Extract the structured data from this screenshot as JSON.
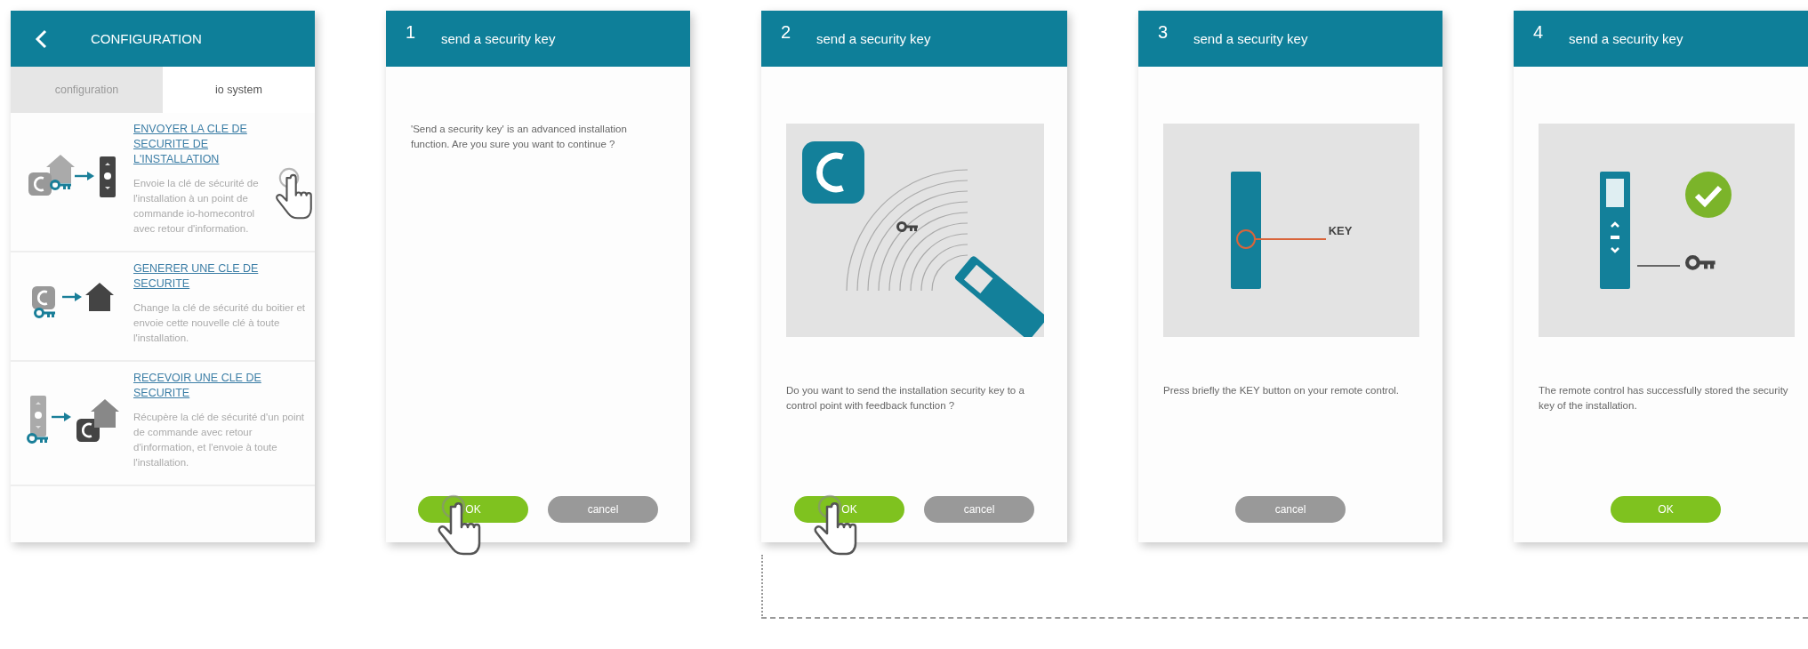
{
  "screens": [
    {
      "kind": "menu",
      "header": {
        "title": "CONFIGURATION",
        "back": true
      },
      "tabs": [
        {
          "label": "configuration",
          "selected": false
        },
        {
          "label": "io system",
          "selected": true
        }
      ],
      "items": [
        {
          "kind": "send",
          "title": "ENVOYER LA CLE DE SECURITE DE L'INSTALLATION",
          "description": "Envoie la clé de sécurité de l'installation à un point de commande io-homecontrol avec retour d'information.",
          "pressed": true
        },
        {
          "kind": "generate",
          "title": "GENERER UNE CLE DE SECURITE",
          "description": "Change la clé de sécurité du boitier et envoie cette nouvelle clé à toute l'installation.",
          "pressed": false
        },
        {
          "kind": "receive",
          "title": "RECEVOIR UNE CLE DE SECURITE",
          "description": "Récupère la clé de sécurité d'un point de commande avec retour d'information, et l'envoie à toute l'installation.",
          "pressed": false
        }
      ]
    },
    {
      "kind": "step",
      "header": {
        "step": "1",
        "title": "send a security key"
      },
      "message": "'Send a security key' is an advanced installation function. Are you sure you want to continue ?",
      "buttons": [
        {
          "kind": "confirm",
          "label": "OK",
          "pressed": true
        },
        {
          "kind": "cancel",
          "label": "cancel",
          "pressed": false
        }
      ]
    },
    {
      "kind": "step",
      "header": {
        "step": "2",
        "title": "send a security key"
      },
      "illustration": {
        "kind": "transmit"
      },
      "message": "Do you want to send the installation security key to a control point with feedback function ?",
      "buttons": [
        {
          "kind": "confirm",
          "label": "OK",
          "pressed": true
        },
        {
          "kind": "cancel",
          "label": "cancel",
          "pressed": false
        }
      ]
    },
    {
      "kind": "step",
      "header": {
        "step": "3",
        "title": "send a security key"
      },
      "illustration": {
        "kind": "key_button",
        "label": "KEY"
      },
      "message": "Press briefly the KEY button on your remote control.",
      "buttons": [
        {
          "kind": "cancel",
          "label": "cancel",
          "pressed": false
        }
      ]
    },
    {
      "kind": "step",
      "header": {
        "step": "4",
        "title": "send a security key"
      },
      "illustration": {
        "kind": "stored"
      },
      "message": "The remote control has successfully stored the security key of the installation.",
      "buttons": [
        {
          "kind": "confirm",
          "label": "OK",
          "pressed": false
        }
      ]
    }
  ]
}
